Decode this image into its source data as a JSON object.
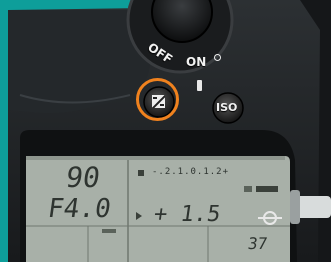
{
  "power_switch": {
    "off_label": "OFF",
    "on_label": "ON"
  },
  "buttons": {
    "exposure_comp_icon": "exposure-compensation-icon",
    "iso_label": "ISO",
    "highlight_color": "#f0821e"
  },
  "lcd": {
    "shutter": "90",
    "aperture": "F4.0",
    "compensation": "+ 1.5",
    "frames": "37",
    "scale": "-.2.1.0.1.2+"
  },
  "colors": {
    "frame": "#0e9e9a",
    "body": "#222527",
    "lcd_bg": "#a8b0a8"
  }
}
